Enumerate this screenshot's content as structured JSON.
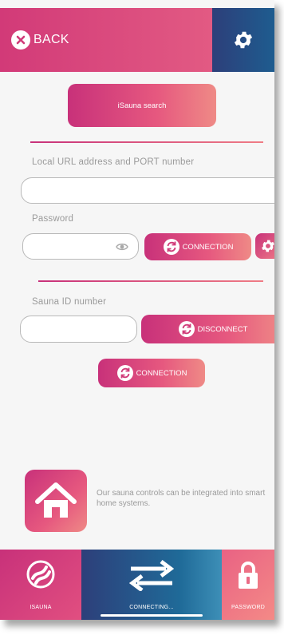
{
  "header": {
    "back_label": "BACK"
  },
  "main": {
    "search_button_label": "iSauna search",
    "url_label": "Local URL address and PORT number",
    "url_value": "",
    "password_label": "Password",
    "password_value": "",
    "connection_button_label": "CONNECTION",
    "sauna_id_label": "Sauna ID number",
    "sauna_id_value": "",
    "disconnect_button_label": "DISCONNECT",
    "connection_button2_label": "CONNECTION",
    "smart_home_text": "Our sauna controls can be integrated into smart home systems."
  },
  "tabbar": {
    "tabs": [
      {
        "label": "ISAUNA",
        "icon": "isauna-logo-icon"
      },
      {
        "label": "CONNECTING...",
        "icon": "swap-arrows-icon",
        "active": true
      },
      {
        "label": "PASSWORD",
        "icon": "lock-icon"
      }
    ]
  },
  "colors": {
    "accent_pink": "#c8317a",
    "accent_coral": "#ef8a86",
    "accent_navy": "#2d3f7a",
    "background": "#f6f6f6"
  }
}
